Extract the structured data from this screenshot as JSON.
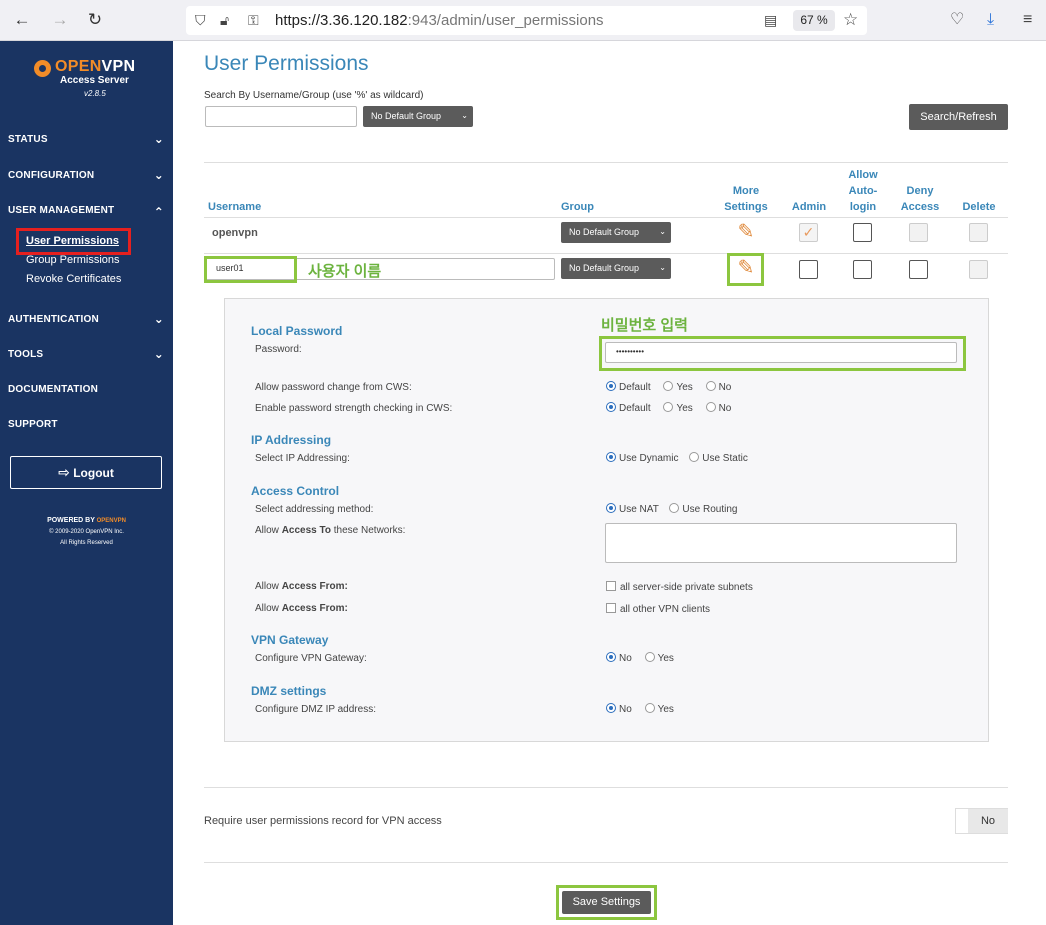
{
  "browser": {
    "url_host": "https://3.36.120.182",
    "url_rest": ":943/admin/user_permissions",
    "zoom": "67 %"
  },
  "sidebar": {
    "brand_open": "OPEN",
    "brand_vpn": "VPN",
    "brand_sub": "Access Server",
    "version": "v2.8.5",
    "nav": [
      "STATUS",
      "CONFIGURATION",
      "USER MANAGEMENT",
      "AUTHENTICATION",
      "TOOLS",
      "DOCUMENTATION",
      "SUPPORT"
    ],
    "sub_items": [
      "User Permissions",
      "Group Permissions",
      "Revoke Certificates"
    ],
    "logout": "Logout",
    "powered_by": "POWERED BY",
    "copyright": "© 2009-2020 OpenVPN Inc.",
    "rights": "All Rights Reserved"
  },
  "page": {
    "title": "User Permissions",
    "search_label": "Search By Username/Group (use '%' as wildcard)",
    "search_value": "",
    "group_filter": "No Default Group",
    "search_button": "Search/Refresh"
  },
  "table": {
    "headers": {
      "username": "Username",
      "group": "Group",
      "more1": "More",
      "more2": "Settings",
      "admin": "Admin",
      "allow1": "Allow",
      "allow2": "Auto-",
      "allow3": "login",
      "deny1": "Deny",
      "deny2": "Access",
      "delete": "Delete"
    },
    "rows": [
      {
        "username": "openvpn",
        "group": "No Default Group"
      },
      {
        "username": "user01",
        "group": "No Default Group"
      }
    ]
  },
  "annotations": {
    "username": "사용자 이름",
    "password": "비밀번호 입력"
  },
  "settings": {
    "local_password": "Local Password",
    "password_label": "Password:",
    "password_value": "••••••••••",
    "allow_change": "Allow password change from CWS:",
    "strength_check": "Enable password strength checking in CWS:",
    "opt_default": "Default",
    "opt_yes": "Yes",
    "opt_no": "No",
    "ip_addressing": "IP Addressing",
    "select_ip": "Select IP Addressing:",
    "use_dynamic": "Use Dynamic",
    "use_static": "Use Static",
    "access_control": "Access Control",
    "select_method": "Select addressing method:",
    "use_nat": "Use NAT",
    "use_routing": "Use Routing",
    "allow_word": "Allow",
    "access_to": "Access To",
    "these_networks": "these Networks:",
    "access_from": "Access From:",
    "all_server_side": "all server-side private subnets",
    "all_other_vpn": "all other VPN clients",
    "vpn_gateway": "VPN Gateway",
    "configure_gateway": "Configure VPN Gateway:",
    "dmz": "DMZ settings",
    "configure_dmz": "Configure DMZ IP address:"
  },
  "footer": {
    "require_label": "Require user permissions record for VPN access",
    "require_value": "No",
    "save": "Save Settings"
  }
}
